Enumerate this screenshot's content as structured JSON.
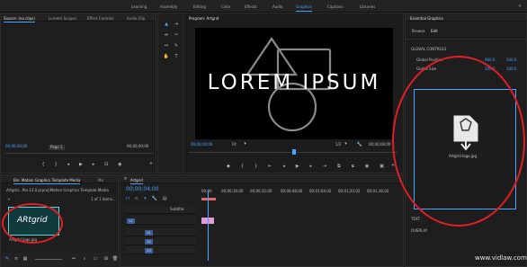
{
  "top_nav": {
    "items": [
      "Learning",
      "Assembly",
      "Editing",
      "Color",
      "Effects",
      "Audio",
      "Graphics",
      "Captions",
      "Libraries"
    ],
    "active": "Graphics"
  },
  "source_panel": {
    "tabs": [
      "Source: (no clips)",
      "Lumetri Scopes",
      "Effect Controls",
      "Audio Clip"
    ],
    "left_tc": "00;00;00;00",
    "page_label": "Page 1",
    "right_tc": "00;00;00;00"
  },
  "program_panel": {
    "title": "Program: Artgrid",
    "overlay_text": "LOREM IPSUM",
    "timecode": "00;00;04;00",
    "fit": "Fit",
    "quality": "1/2",
    "duration": "00;00;08;00"
  },
  "essential_graphics": {
    "title": "Essential Graphics",
    "tabs": [
      "Browse",
      "Edit"
    ],
    "active_tab": "Edit",
    "section_global": "GLOBAL CONTROLS",
    "rows": [
      {
        "label": "Global Position",
        "x": "960.0",
        "y": "540.0"
      },
      {
        "label": "Global Size",
        "x": "100.0",
        "y": "100.0"
      }
    ],
    "logo_label": "Artgrid logo.jpg",
    "section_text": "TEXT",
    "section_overlay": "OVERLAY"
  },
  "project_panel": {
    "tabs": [
      "Bin: Motion Graphics Template Media",
      "Me"
    ],
    "path": "Artgrid...Pro 13.0.prproj\\Motion Graphics Template Media",
    "count": "1 of 1 items...",
    "thumb_text": "ARtgrid",
    "thumb_caption": "Artgrid logo.jpg"
  },
  "timeline": {
    "tab": "Artgrid",
    "timecode": "00;00;04;00",
    "ruler": [
      "00;00",
      "00;00;16;00",
      "00;00;32;00",
      "00;00;48;00",
      "00;01;04;02",
      "00;01;20;02",
      "00;01;36;02"
    ],
    "subtitle": "Subtitle",
    "tracks": [
      "V1",
      "A1",
      "A2",
      "A3"
    ]
  },
  "watermark": "www.vidlaw.com"
}
